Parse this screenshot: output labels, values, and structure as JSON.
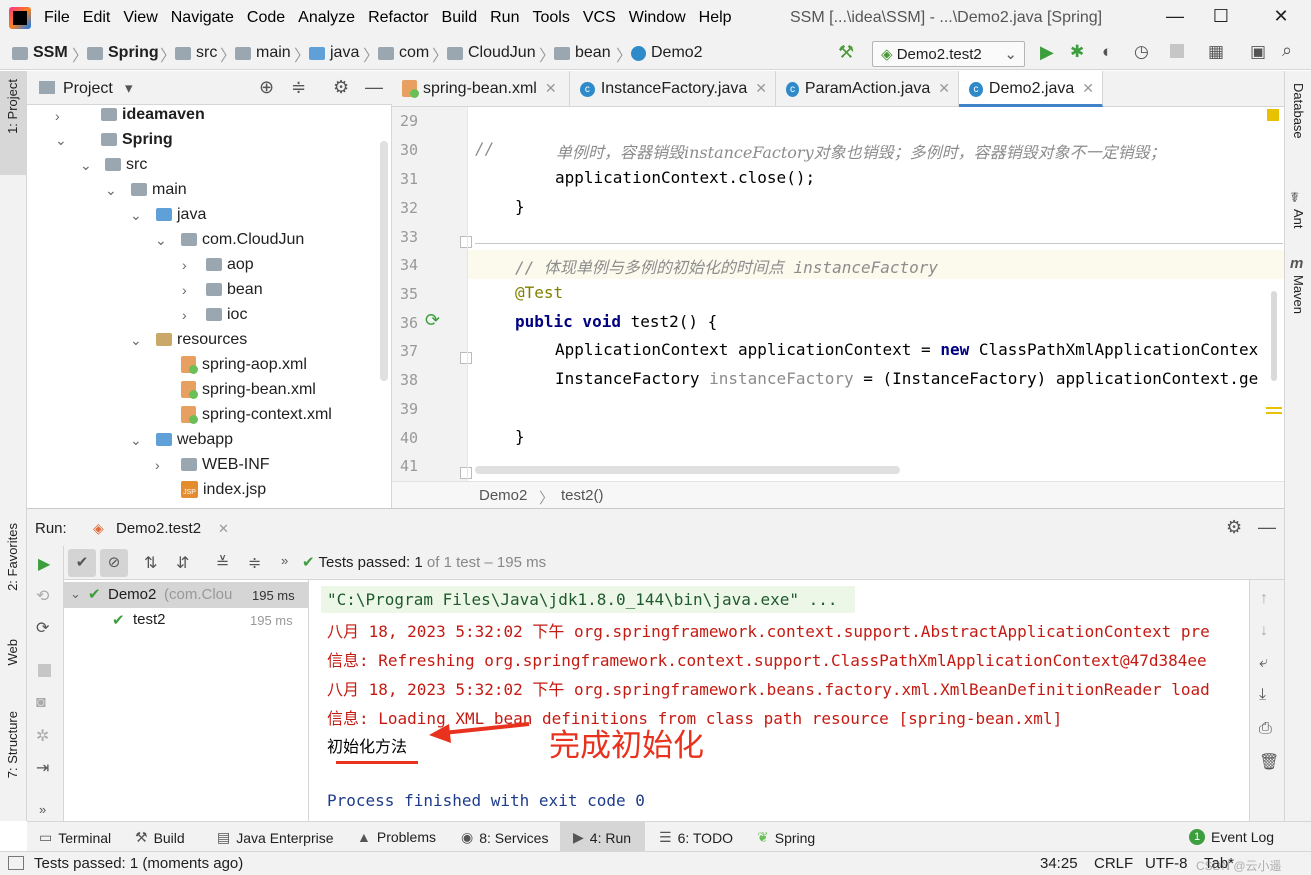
{
  "menu": [
    "File",
    "Edit",
    "View",
    "Navigate",
    "Code",
    "Analyze",
    "Refactor",
    "Build",
    "Run",
    "Tools",
    "VCS",
    "Window",
    "Help"
  ],
  "window_title": "SSM [...\\idea\\SSM] - ...\\Demo2.java [Spring]",
  "breadcrumbs": [
    "SSM",
    "Spring",
    "src",
    "main",
    "java",
    "com",
    "CloudJun",
    "bean",
    "Demo2"
  ],
  "run_config": "Demo2.test2",
  "left_stripe": {
    "project": "1: Project",
    "favorites": "2: Favorites",
    "web": "Web",
    "structure": "7: Structure"
  },
  "right_stripe": {
    "database": "Database",
    "ant": "Ant",
    "maven": "Maven"
  },
  "project_panel": {
    "title": "Project",
    "tree": [
      {
        "label": "ideamaven",
        "bold": true
      },
      {
        "label": "Spring",
        "bold": true
      },
      {
        "label": "src"
      },
      {
        "label": "main"
      },
      {
        "label": "java"
      },
      {
        "label": "com.CloudJun"
      },
      {
        "label": "aop"
      },
      {
        "label": "bean"
      },
      {
        "label": "ioc"
      },
      {
        "label": "resources"
      },
      {
        "label": "spring-aop.xml"
      },
      {
        "label": "spring-bean.xml"
      },
      {
        "label": "spring-context.xml"
      },
      {
        "label": "webapp"
      },
      {
        "label": "WEB-INF"
      },
      {
        "label": "index.jsp"
      }
    ]
  },
  "editor": {
    "tabs": [
      "spring-bean.xml",
      "InstanceFactory.java",
      "ParamAction.java",
      "Demo2.java"
    ],
    "line_numbers": [
      "29",
      "30",
      "31",
      "32",
      "33",
      "34",
      "35",
      "36",
      "37",
      "38",
      "39",
      "40",
      "41"
    ],
    "lines": {
      "l30_prefix": "//",
      "l30_comment": "单例时，容器销毁instanceFactory对象也销毁；多例时，容器销毁对象不一定销毁；",
      "l31": "applicationContext.close();",
      "l32": "}",
      "l34_comment": "// 体现单例与多例的初始化的时间点 instanceFactory",
      "l35_annotation": "@Test",
      "l36_kw": "public void",
      "l36_rest": " test2() {",
      "l37_a": "ApplicationContext applicationContext = ",
      "l37_kw": "new",
      "l37_b": " ClassPathXmlApplicationContex",
      "l38_a": "InstanceFactory ",
      "l38_var": "instanceFactory",
      "l38_b": " = (InstanceFactory) applicationContext.ge",
      "l40": "}"
    },
    "status_crumbs": [
      "Demo2",
      "test2()"
    ]
  },
  "run_panel": {
    "label": "Run:",
    "tab": "Demo2.test2",
    "tests_passed_label": "Tests passed:",
    "tests_passed_count": "1",
    "tests_passed_suffix": "of 1 test – 195 ms",
    "tree": [
      {
        "label": "Demo2",
        "sub": "(com.Clou",
        "time": "195 ms"
      },
      {
        "label": "test2",
        "time": "195 ms"
      }
    ],
    "console": [
      "\"C:\\Program Files\\Java\\jdk1.8.0_144\\bin\\java.exe\" ...",
      "八月 18, 2023 5:32:02 下午 org.springframework.context.support.AbstractApplicationContext pre",
      "信息: Refreshing org.springframework.context.support.ClassPathXmlApplicationContext@47d384ee",
      "八月 18, 2023 5:32:02 下午 org.springframework.beans.factory.xml.XmlBeanDefinitionReader load",
      "信息: Loading XML bean definitions from class path resource [spring-bean.xml]",
      "初始化方法",
      "",
      "Process finished with exit code 0"
    ],
    "annotation_text": "完成初始化",
    "annotation_color": "#e8321e"
  },
  "bottom_tools": [
    "Terminal",
    "Build",
    "Java Enterprise",
    "Problems",
    "8: Services",
    "4: Run",
    "6: TODO",
    "Spring",
    "Event Log"
  ],
  "event_log_count": "1",
  "status": {
    "message": "Tests passed: 1 (moments ago)",
    "position": "34:25",
    "line_sep": "CRLF",
    "encoding": "UTF-8",
    "indent": "Tab*",
    "watermark": "CSDN @云小遥"
  }
}
